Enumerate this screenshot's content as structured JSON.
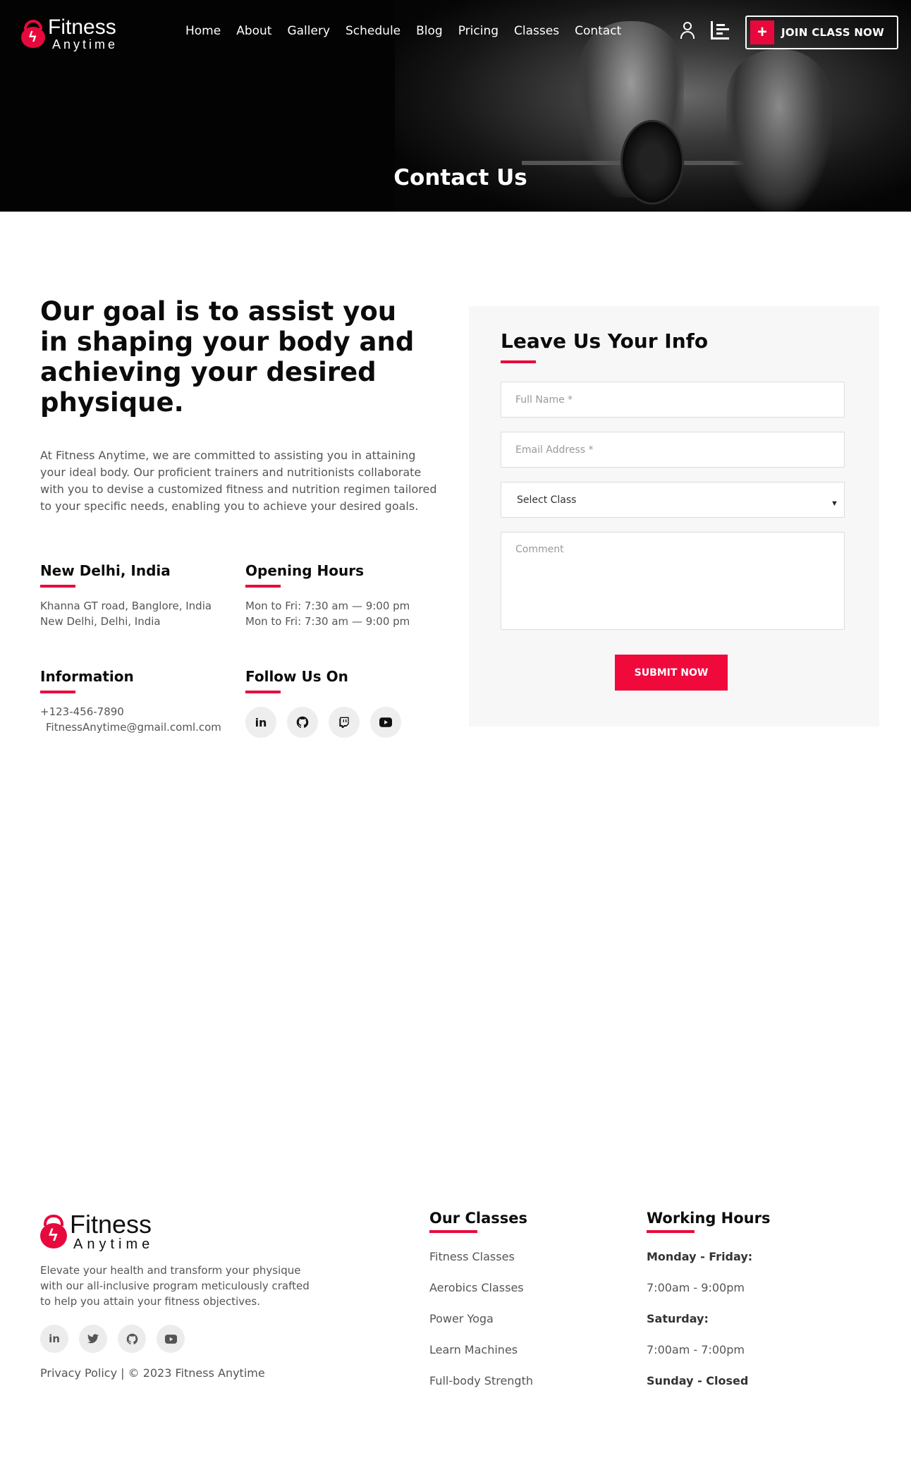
{
  "brand": {
    "line1": "Fitness",
    "line2": "Anytime",
    "accent_color": "#e8093c"
  },
  "nav": {
    "items": [
      "Home",
      "About",
      "Gallery",
      "Schedule",
      "Blog",
      "Pricing",
      "Classes",
      "Contact"
    ]
  },
  "header": {
    "join_label": "JOIN CLASS NOW",
    "join_icon": "plus",
    "icons": [
      "user-icon",
      "chart-icon"
    ]
  },
  "hero": {
    "title": "Contact Us"
  },
  "intro": {
    "headline": "Our goal is to assist you in shaping your body and achieving your desired physique.",
    "body": "At Fitness Anytime, we are committed to assisting you in attaining your ideal body. Our proficient trainers and nutritionists collaborate with you to devise a customized fitness and nutrition regimen tailored to your specific needs, enabling you to achieve your desired goals."
  },
  "location": {
    "title": "New Delhi, India",
    "line1": "Khanna GT road, Banglore, India",
    "line2": "New Delhi, Delhi, India"
  },
  "hours": {
    "title": "Opening Hours",
    "line1": "Mon to Fri: 7:30 am — 9:00 pm",
    "line2": "Mon to Fri: 7:30 am — 9:00 pm"
  },
  "information": {
    "title": "Information",
    "phone": "+123-456-7890",
    "email": "FitnessAnytime@gmail.coml.com"
  },
  "follow": {
    "title": "Follow Us On",
    "icons": [
      "linkedin-icon",
      "github-icon",
      "twitch-icon",
      "youtube-icon"
    ]
  },
  "form": {
    "title": "Leave Us Your Info",
    "name_placeholder": "Full Name *",
    "email_placeholder": "Email Address *",
    "select_value": "Select Class",
    "comment_placeholder": "Comment",
    "submit_label": "SUBMIT NOW"
  },
  "footer": {
    "description": "Elevate your health and transform your physique with our all-inclusive program meticulously crafted to help you attain your fitness objectives.",
    "social_icons": [
      "linkedin-icon",
      "twitter-icon",
      "github-icon",
      "youtube-icon"
    ],
    "copyright": "Privacy Policy | © 2023 Fitness Anytime",
    "classes_title": "Our Classes",
    "classes": [
      "Fitness Classes",
      "Aerobics Classes",
      "Power Yoga",
      "Learn Machines",
      "Full-body Strength"
    ],
    "hours_title": "Working Hours",
    "hours": [
      "Monday - Friday:",
      "7:00am - 9:00pm",
      "Saturday:",
      "7:00am - 7:00pm",
      "Sunday - Closed"
    ]
  }
}
